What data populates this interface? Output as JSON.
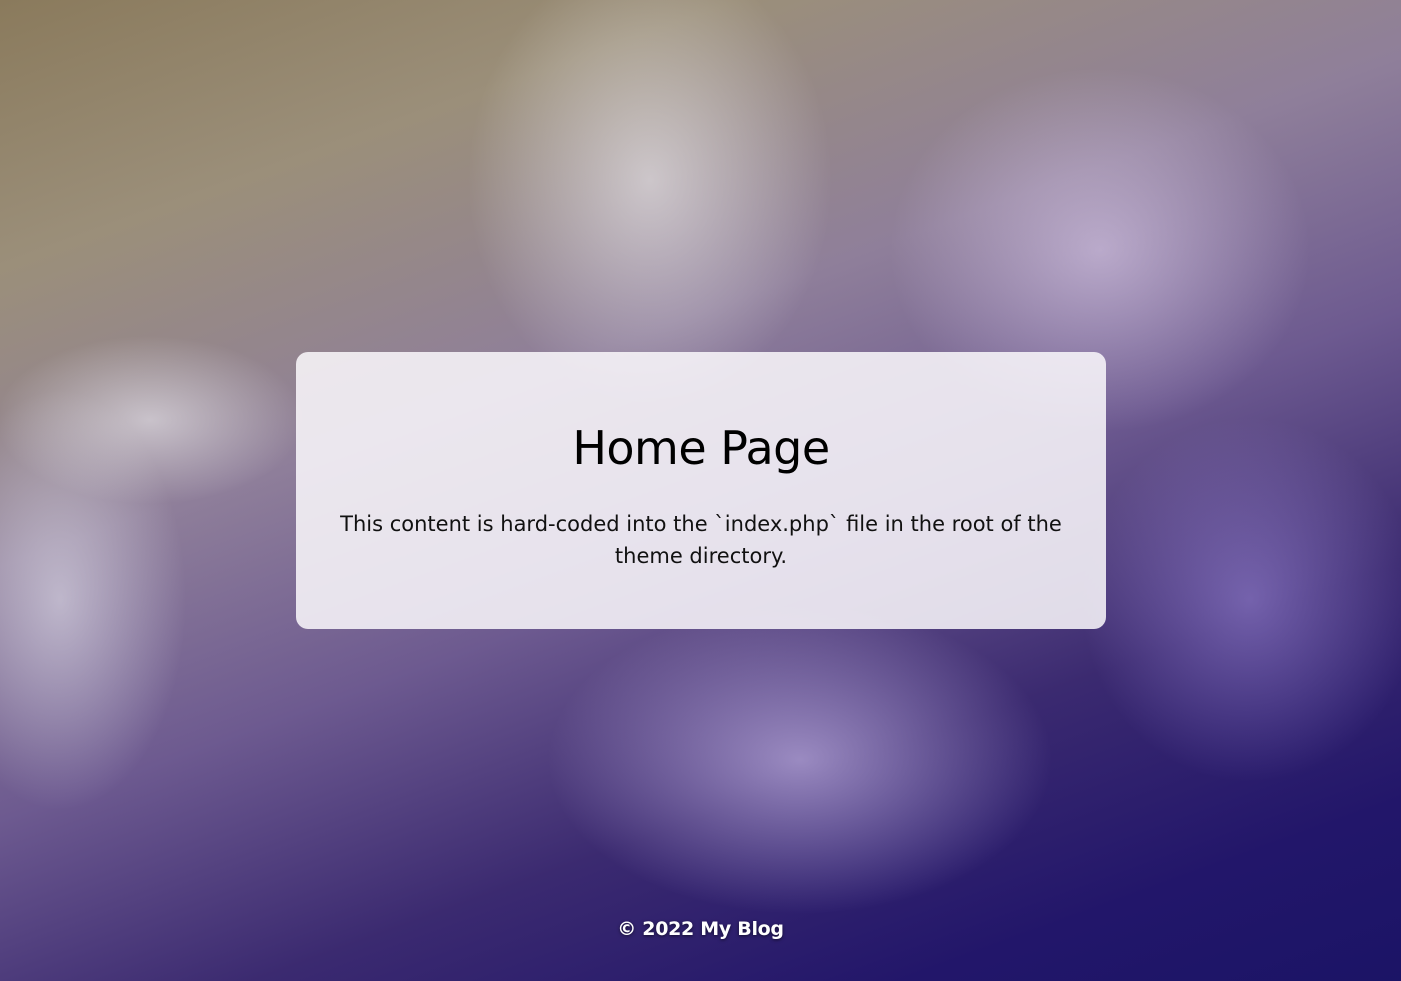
{
  "main": {
    "title": "Home Page",
    "description": "This content is hard-coded into the `index.php` file in the root of the theme directory."
  },
  "footer": {
    "text": "© 2022 My Blog"
  }
}
